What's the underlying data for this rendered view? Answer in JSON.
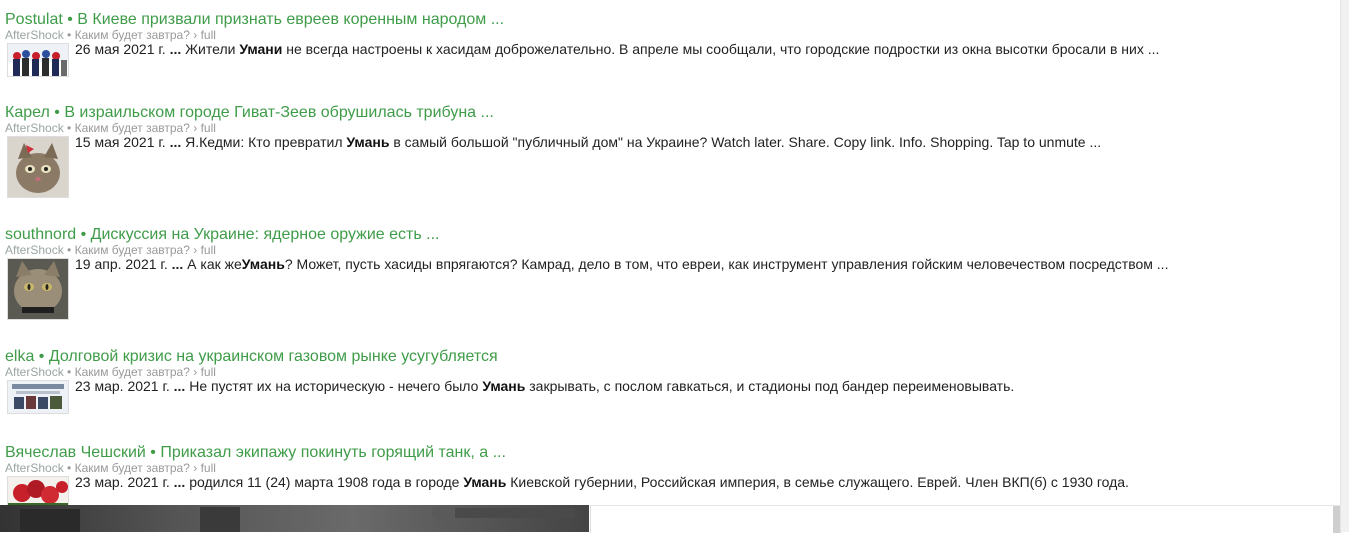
{
  "results": [
    {
      "title": "Postulat • В Киеве призвали признать евреев коренным народом ...",
      "site": "AfterShock",
      "path": "• Каким будет завтра? › full",
      "date": "26 мая 2021 г.",
      "ellipsis": "...",
      "pre": "Жители",
      "bold": "Умани",
      "post": "не всегда настроены к хасидам доброжелательно. В апреле мы сообщали, что городские подростки из окна высотки бросали в них ..."
    },
    {
      "title": "Карел • В израильском городе Гиват-Зеев обрушилась трибуна ...",
      "site": "AfterShock",
      "path": "• Каким будет завтра? › full",
      "date": "15 мая 2021 г.",
      "ellipsis": "...",
      "pre": "Я.Кедми: Кто превратил",
      "bold": "Умань",
      "post": "в самый большой \"публичный дом\" на Украине? Watch later. Share. Copy link. Info. Shopping. Tap to unmute ..."
    },
    {
      "title": "southnord • Дискуссия на Украине: ядерное оружие есть ...",
      "site": "AfterShock",
      "path": "• Каким будет завтра? › full",
      "date": "19 апр. 2021 г.",
      "ellipsis": "...",
      "pre": "А как же",
      "bold": "Умань",
      "post": "? Может, пусть хасиды впрягаются? Камрад, дело в том, что евреи, как инструмент управления гойским человечеством посредством ..."
    },
    {
      "title": "elka • Долговой кризис на украинском газовом рынке усугубляется",
      "site": "AfterShock",
      "path": "• Каким будет завтра? › full",
      "date": "23 мар. 2021 г.",
      "ellipsis": "...",
      "pre": "Не пустят их на историческую - нечего было",
      "bold": "Умань",
      "post": "закрывать, с послом гавкаться, и стадионы под бандер переименовывать."
    },
    {
      "title": "Вячеслав Чешский • Приказал экипажу покинуть горящий танк, а ...",
      "site": "AfterShock",
      "path": "• Каким будет завтра? › full",
      "date": "23 мар. 2021 г.",
      "ellipsis": "...",
      "pre": "родился 11 (24) марта 1908 года в городе",
      "bold": "Умань",
      "post": "Киевской губернии, Российская империя, в семье служащего. Еврей. Член ВКП(б) с 1930 года."
    }
  ]
}
